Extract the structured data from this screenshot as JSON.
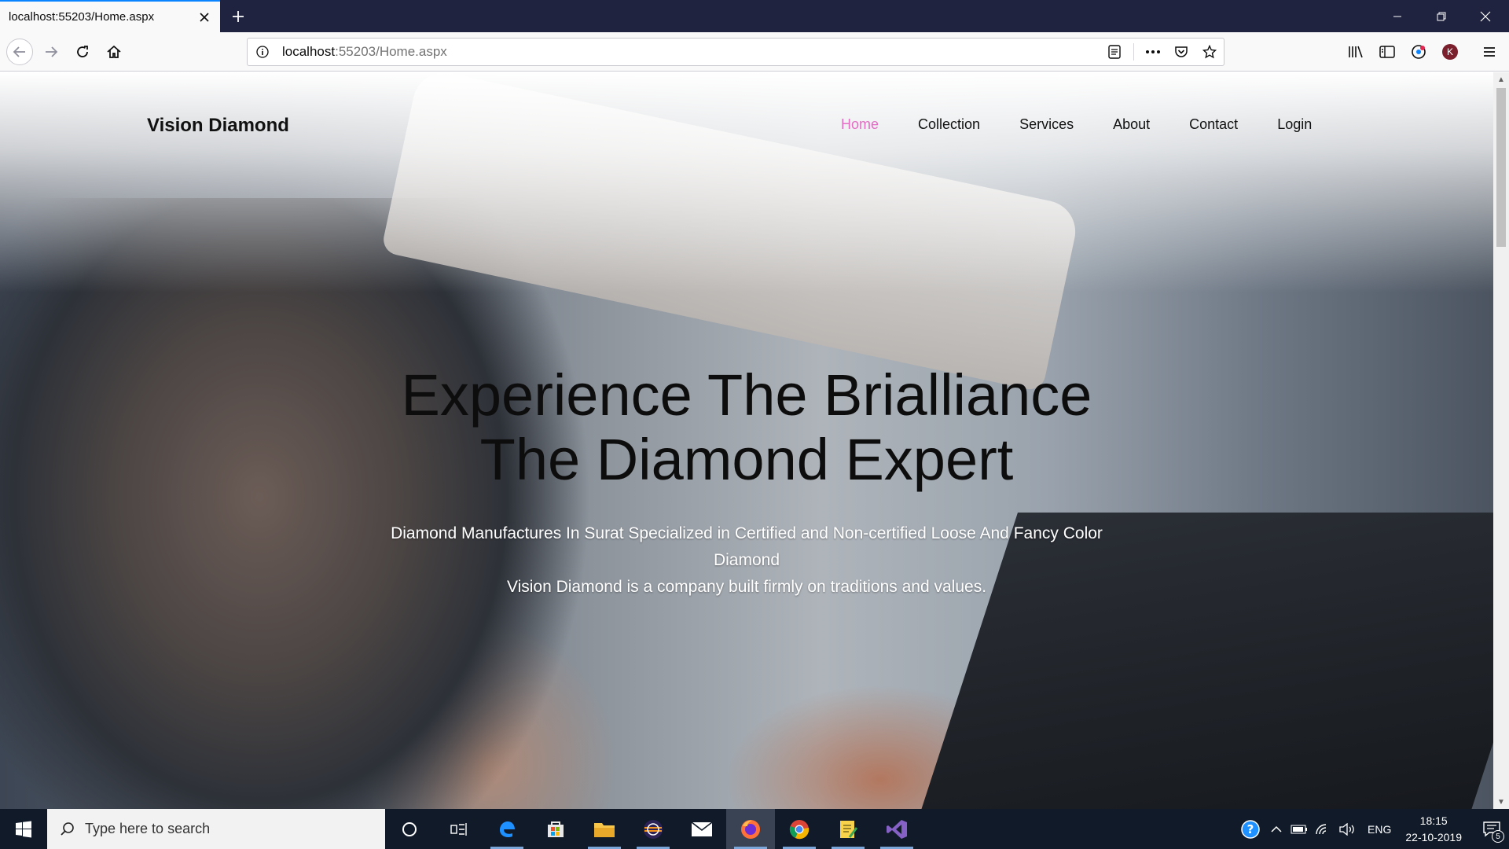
{
  "browser": {
    "tab_title": "localhost:55203/Home.aspx",
    "url_host": "localhost",
    "url_rest": ":55203/Home.aspx",
    "account_initial": "K"
  },
  "site": {
    "brand": "Vision Diamond",
    "nav": [
      "Home",
      "Collection",
      "Services",
      "About",
      "Contact",
      "Login"
    ],
    "active_nav": "Home",
    "accent_color": "#e36cc5",
    "hero_line1": "Experience The Brialliance",
    "hero_line2": "The Diamond Expert",
    "hero_sub_line1": "Diamond Manufactures In Surat Specialized in Certified and Non-certified Loose And Fancy Color",
    "hero_sub_line2": "Diamond",
    "hero_sub_line3": "Vision Diamond is a company built firmly on traditions and values."
  },
  "taskbar": {
    "search_placeholder": "Type here to search",
    "language": "ENG",
    "time": "18:15",
    "date": "22-10-2019",
    "notification_count": "5"
  }
}
